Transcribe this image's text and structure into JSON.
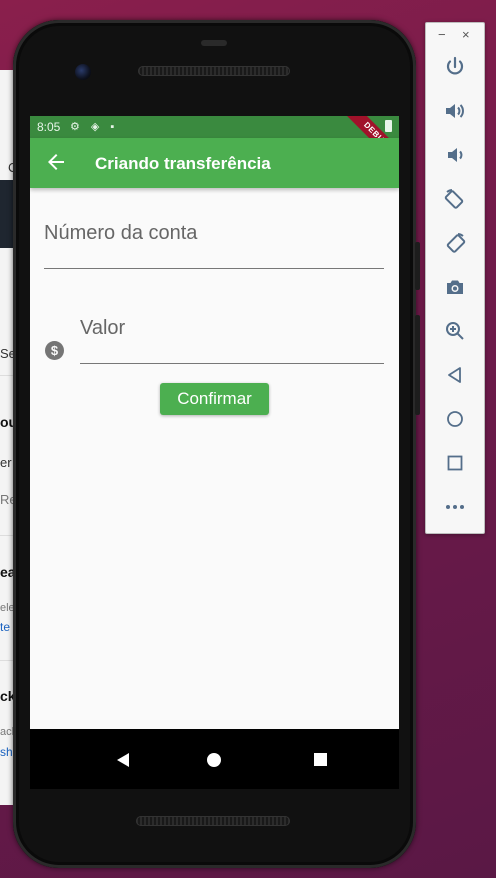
{
  "background_window": {
    "fragments": [
      "C",
      "Se",
      "ou",
      "er",
      "Re",
      "ea",
      "elea",
      "te",
      "cka",
      "ach",
      "sh"
    ]
  },
  "status_bar": {
    "time": "8:05",
    "debug_label": "DEBUG"
  },
  "app_bar": {
    "title": "Criando transferência",
    "back_icon": "arrow-left-icon"
  },
  "form": {
    "account_field": {
      "label": "Número da conta",
      "value": ""
    },
    "value_field": {
      "label": "Valor",
      "value": "",
      "icon": "monetization-icon"
    },
    "confirm_label": "Confirmar"
  },
  "colors": {
    "primary": "#4caf50",
    "status_bar": "#3a8a3f",
    "debug_banner": "#a0122a"
  },
  "emulator_toolbar": {
    "minimize": "−",
    "close": "×",
    "tools": [
      "power-icon",
      "volume-up-icon",
      "volume-down-icon",
      "rotate-left-icon",
      "rotate-right-icon",
      "camera-icon",
      "zoom-icon",
      "back-icon",
      "home-icon",
      "overview-icon",
      "more-icon"
    ]
  }
}
